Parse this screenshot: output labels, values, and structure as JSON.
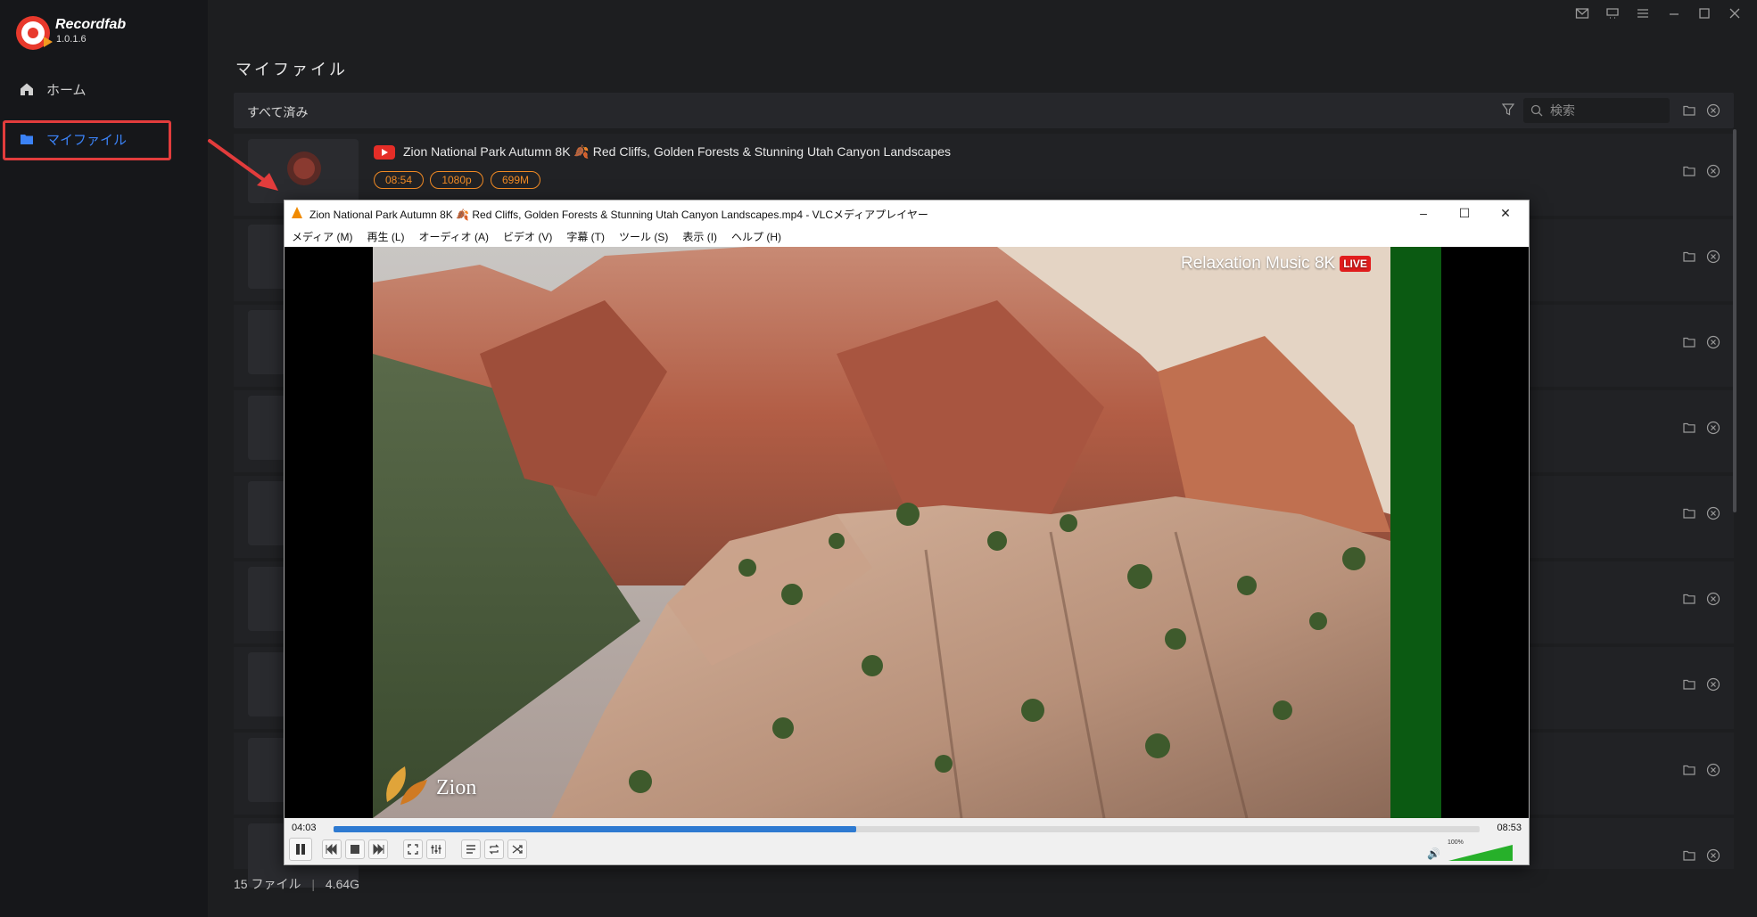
{
  "app": {
    "name": "Recordfab",
    "version": "1.0.1.6"
  },
  "sidebar": {
    "items": [
      {
        "label": "ホーム",
        "icon": "home-icon"
      },
      {
        "label": "マイファイル",
        "icon": "folder-icon"
      }
    ]
  },
  "page": {
    "title": "マイファイル",
    "filter_label": "すべて済み",
    "search_placeholder": "検索"
  },
  "file_list": {
    "first_item": {
      "title": "Zion National Park Autumn 8K 🍂 Red Cliffs, Golden Forests & Stunning Utah Canyon Landscapes",
      "source_icon": "youtube-icon",
      "badges": {
        "duration": "08:54",
        "resolution": "1080p",
        "size": "699M"
      }
    }
  },
  "footer": {
    "count": "15 ファイル",
    "separator": "|",
    "total_size": "4.64G"
  },
  "vlc": {
    "title": "Zion National Park Autumn 8K 🍂 Red Cliffs, Golden Forests & Stunning Utah Canyon Landscapes.mp4 - VLCメディアプレイヤー",
    "menu": [
      "メディア (M)",
      "再生 (L)",
      "オーディオ (A)",
      "ビデオ (V)",
      "字幕 (T)",
      "ツール (S)",
      "表示 (I)",
      "ヘルプ (H)"
    ],
    "video_overlay": {
      "channel": "Relaxation Music 8K",
      "live": "LIVE",
      "logo_text": "Zion"
    },
    "time_elapsed": "04:03",
    "time_total": "08:53",
    "progress_fraction": 0.456,
    "volume_label": "100%",
    "volume_fraction": 1.0
  },
  "colors": {
    "accent": "#3b82f6",
    "badge": "#f08a24",
    "highlight": "#e23c3c",
    "seek": "#2e7ad1"
  }
}
